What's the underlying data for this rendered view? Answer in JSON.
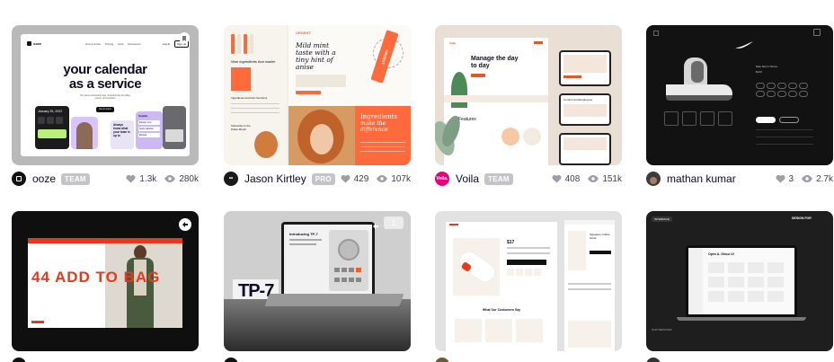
{
  "shots": [
    {
      "thumb": {
        "nav": [
          "How it works",
          "Pricing",
          "Help",
          "Resources"
        ],
        "login": "Log in",
        "signup": "Sign up",
        "headline1": "your calendar",
        "headline2": "as a service",
        "sub": "The same productivity app. Schedule like for today, events, and contacts",
        "cta": "Get in touch",
        "date": "January 25, 2022",
        "promo": "Always know what your team is up to",
        "contact": "Sophia",
        "tasks": [
          "Design sync",
          "Team standup",
          "Review"
        ]
      },
      "author": "ooze",
      "badge": "TEAM",
      "likes": "1.3k",
      "views": "280k"
    },
    {
      "thumb": {
        "brand": "URGENT",
        "headline": "Mild mint taste with a tiny hint of anise",
        "side_title": "Nine ingredients that matter",
        "list_title": "Ingredients and their functions",
        "sub_label": "Subscribe to the Pollen Brush",
        "tube_text": "URGENT",
        "quote1": "Ingredients",
        "quote2": "make the difference"
      },
      "author": "Jason Kirtley",
      "badge": "PRO",
      "likes": "429",
      "views": "107k"
    },
    {
      "thumb": {
        "brand": "Voila",
        "headline": "Manage the day to day",
        "features": "Features",
        "panel2": "Comfort and Employees"
      },
      "author": "Voila",
      "badge": "TEAM",
      "likes": "408",
      "views": "151k"
    },
    {
      "thumb": {
        "product": "Nike Men's Shoes",
        "price": "$120",
        "sizes": [
          "US 7",
          "US 7.5",
          "US 8",
          "US 8.5",
          "US 9",
          "US 9.5",
          "US 10",
          "US 10.5",
          "US 11",
          "US 11.5",
          "US 12",
          "US 13"
        ],
        "add": "Add to Bag",
        "fav": "Favorite"
      },
      "author": "mathan kumar",
      "badge": "",
      "likes": "3",
      "views": "2.7k"
    },
    {
      "thumb": {
        "headline": "44 ADD TO BAG"
      },
      "author": "",
      "badge": "",
      "likes": "",
      "views": ""
    },
    {
      "thumb": {
        "title": "Introducing TP-7",
        "model": "TP-7",
        "count": "1"
      },
      "author": "",
      "badge": "",
      "likes": "",
      "views": ""
    },
    {
      "thumb": {
        "price": "$17",
        "product": "Signature Coffee Grind",
        "section": "What Our Customers Say"
      },
      "author": "",
      "badge": "",
      "likes": "",
      "views": ""
    },
    {
      "thumb": {
        "tag": "INTERFACE",
        "heading": "DESIGN FOR",
        "screen_title": "Open A. Ginco UI",
        "footer": "OUR SERVICES"
      },
      "author": "",
      "badge": "",
      "likes": "",
      "views": ""
    }
  ]
}
